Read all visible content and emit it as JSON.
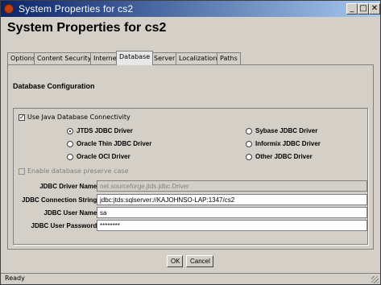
{
  "window": {
    "title": "System Properties for cs2"
  },
  "heading": "System Properties for cs2",
  "tabs": [
    {
      "label": "Options",
      "active": false
    },
    {
      "label": "Content Security",
      "active": false
    },
    {
      "label": "Internet",
      "active": false
    },
    {
      "label": "Database",
      "active": true
    },
    {
      "label": "Server",
      "active": false
    },
    {
      "label": "Localization",
      "active": false
    },
    {
      "label": "Paths",
      "active": false
    }
  ],
  "section_title": "Database Configuration",
  "use_jdbc": {
    "label": "Use Java Database Connectivity",
    "checked": true
  },
  "drivers": [
    {
      "label": "JTDS JDBC Driver",
      "selected": true
    },
    {
      "label": "Oracle Thin JDBC Driver",
      "selected": false
    },
    {
      "label": "Oracle OCI Driver",
      "selected": false
    },
    {
      "label": "Sybase JDBC Driver",
      "selected": false
    },
    {
      "label": "Informix JDBC Driver",
      "selected": false
    },
    {
      "label": "Other JDBC Driver",
      "selected": false
    }
  ],
  "preserve_case": {
    "label": "Enable database preserve case",
    "checked": false,
    "enabled": false
  },
  "fields": [
    {
      "label": "JDBC Driver Name:",
      "value": "net.sourceforge.jtds.jdbc.Driver",
      "enabled": false
    },
    {
      "label": "JDBC Connection String:",
      "value": "jdbc:jtds:sqlserver://KAJOHNSO-LAP:1347/cs2",
      "enabled": true
    },
    {
      "label": "JDBC User Name:",
      "value": "sa",
      "enabled": true
    },
    {
      "label": "JDBC User Password:",
      "value": "********",
      "enabled": true
    }
  ],
  "buttons": {
    "ok": "OK",
    "cancel": "Cancel"
  },
  "status": "Ready"
}
